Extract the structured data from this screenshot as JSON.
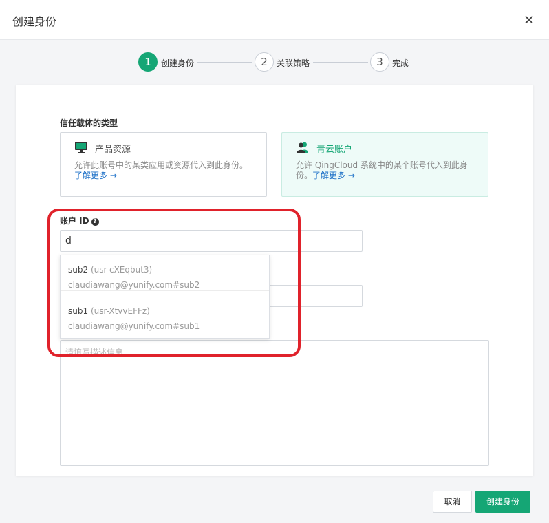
{
  "dialog": {
    "title": "创建身份",
    "close_icon": "close-icon"
  },
  "steps": [
    {
      "number": "1",
      "label": "创建身份",
      "active": true
    },
    {
      "number": "2",
      "label": "关联策略",
      "active": false
    },
    {
      "number": "3",
      "label": "完成",
      "active": false
    }
  ],
  "trust_type": {
    "label": "信任载体的类型",
    "options": [
      {
        "icon": "monitor-icon",
        "title": "产品资源",
        "desc": "允许此账号中的某类应用或资源代入到此身份。",
        "link": "了解更多 →",
        "selected": false
      },
      {
        "icon": "users-icon",
        "title": "青云账户",
        "desc": "允许 QingCloud 系统中的某个账号代入到此身份。",
        "link": "了解更多 →",
        "selected": true
      }
    ]
  },
  "account_id": {
    "label": "账户 ID",
    "help_icon": "question-circle-icon",
    "value": "d"
  },
  "suggestions": [
    {
      "name": "sub2",
      "id": "(usr-cXEqbut3)",
      "email": "claudiawang@yunify.com#sub2"
    },
    {
      "name": "sub1",
      "id": "(usr-XtvvEFFz)",
      "email": "claudiawang@yunify.com#sub1"
    }
  ],
  "description": {
    "placeholder": "请填写描述信息"
  },
  "footer": {
    "cancel_label": "取消",
    "submit_label": "创建身份"
  },
  "colors": {
    "accent": "#15a675",
    "link": "#1b6fc7",
    "highlight": "#e0222b"
  }
}
